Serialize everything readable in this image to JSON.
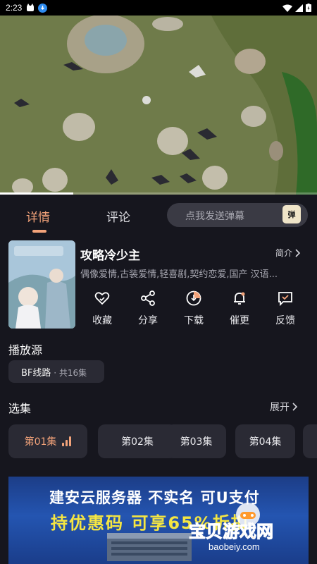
{
  "status_bar": {
    "time": "2:23"
  },
  "video": {
    "progress_fraction": 0.23
  },
  "tabs": [
    {
      "label": "详情",
      "active": true
    },
    {
      "label": "评论",
      "active": false
    }
  ],
  "danmaku": {
    "placeholder": "点我发送弹幕",
    "icon_text": "弹"
  },
  "drama": {
    "title": "攻略冷少主",
    "intro_label": "简介",
    "tags": "偶像爱情,古装爱情,轻喜剧,契约恋爱,国产 汉语..."
  },
  "actions": [
    {
      "label": "收藏",
      "icon": "heart-icon"
    },
    {
      "label": "分享",
      "icon": "share-icon"
    },
    {
      "label": "下载",
      "icon": "download-icon"
    },
    {
      "label": "催更",
      "icon": "bell-icon"
    },
    {
      "label": "反馈",
      "icon": "feedback-icon"
    }
  ],
  "source": {
    "title": "播放源",
    "chip_name": "BF线路",
    "chip_count": " · 共16集"
  },
  "episodes": {
    "title": "选集",
    "expand_label": "展开",
    "items": [
      "第01集",
      "第02集",
      "第03集",
      "第04集"
    ],
    "active_index": 0
  },
  "ad": {
    "line1": "建安云服务器 不实名 可U支付",
    "line2": "持优惠码 可享65%折扣"
  },
  "watermark": {
    "text": "宝贝游戏网",
    "url": "baobeiy.com"
  },
  "colors": {
    "accent": "#f3a37a",
    "background": "#16161e",
    "chip": "#2a2a34"
  }
}
